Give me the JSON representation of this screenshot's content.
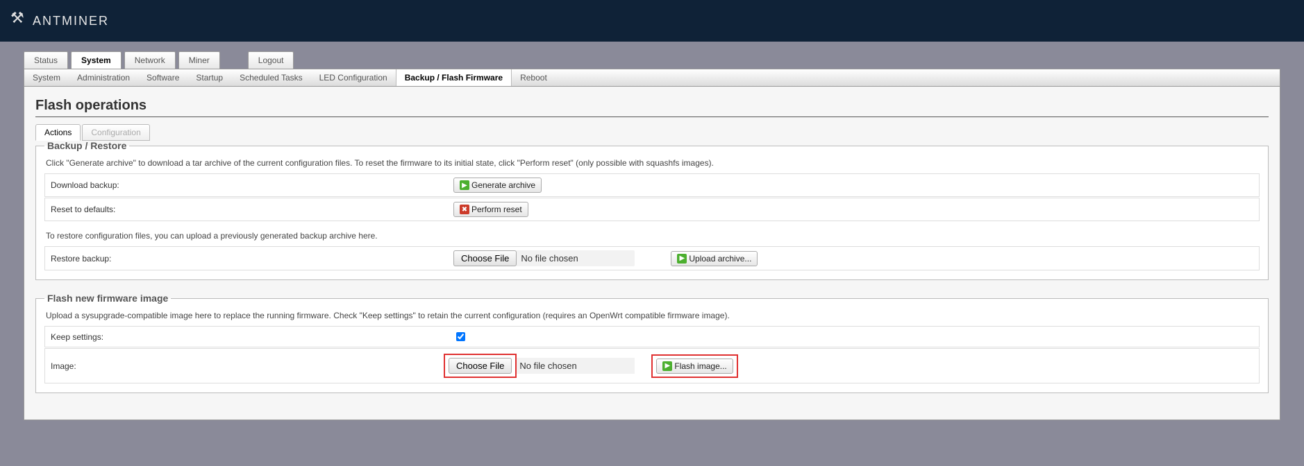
{
  "brand": "ANTMINER",
  "nav": {
    "main": [
      {
        "label": "Status",
        "active": false
      },
      {
        "label": "System",
        "active": true
      },
      {
        "label": "Network",
        "active": false
      },
      {
        "label": "Miner",
        "active": false
      }
    ],
    "logout": "Logout",
    "sub": [
      {
        "label": "System",
        "active": false
      },
      {
        "label": "Administration",
        "active": false
      },
      {
        "label": "Software",
        "active": false
      },
      {
        "label": "Startup",
        "active": false
      },
      {
        "label": "Scheduled Tasks",
        "active": false
      },
      {
        "label": "LED Configuration",
        "active": false
      },
      {
        "label": "Backup / Flash Firmware",
        "active": true
      },
      {
        "label": "Reboot",
        "active": false
      }
    ]
  },
  "page": {
    "title": "Flash operations",
    "section_tabs": [
      {
        "label": "Actions",
        "active": true
      },
      {
        "label": "Configuration",
        "active": false,
        "disabled": true
      }
    ]
  },
  "backup": {
    "legend": "Backup / Restore",
    "desc": "Click \"Generate archive\" to download a tar archive of the current configuration files. To reset the firmware to its initial state, click \"Perform reset\" (only possible with squashfs images).",
    "download_label": "Download backup:",
    "generate_btn": "Generate archive",
    "reset_label": "Reset to defaults:",
    "reset_btn": "Perform reset",
    "restore_desc": "To restore configuration files, you can upload a previously generated backup archive here.",
    "restore_label": "Restore backup:",
    "choose_file": "Choose File",
    "no_file": "No file chosen",
    "upload_btn": "Upload archive..."
  },
  "flash": {
    "legend": "Flash new firmware image",
    "desc": "Upload a sysupgrade-compatible image here to replace the running firmware. Check \"Keep settings\" to retain the current configuration (requires an OpenWrt compatible firmware image).",
    "keep_label": "Keep settings:",
    "keep_checked": true,
    "image_label": "Image:",
    "choose_file": "Choose File",
    "no_file": "No file chosen",
    "flash_btn": "Flash image..."
  }
}
